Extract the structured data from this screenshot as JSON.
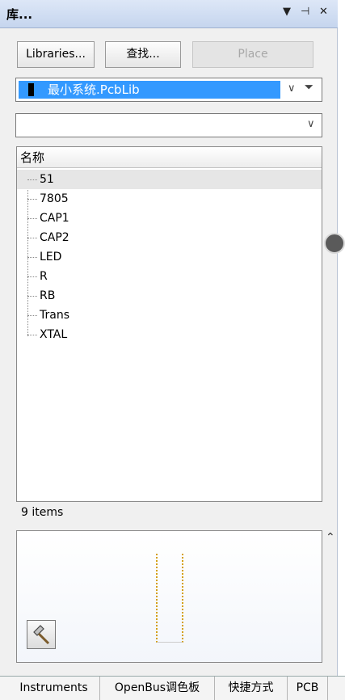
{
  "panel": {
    "title": "库...",
    "title_icons": [
      "dropdown-icon",
      "pin-icon",
      "close-icon"
    ]
  },
  "toolbar": {
    "libraries_label": "Libraries...",
    "search_label": "查找...",
    "place_label": "Place"
  },
  "library_combo": {
    "selected": "最小系统.PcbLib"
  },
  "filter_combo": {
    "value": ""
  },
  "list": {
    "header": "名称",
    "items": [
      "51",
      "7805",
      "CAP1",
      "CAP2",
      "LED",
      "R",
      "RB",
      "Trans",
      "XTAL"
    ],
    "selected_index": 0,
    "count_text": "9 items"
  },
  "bottom_tabs": [
    {
      "label": "Instruments"
    },
    {
      "label": "OpenBus调色板"
    },
    {
      "label": "快捷方式"
    },
    {
      "label": "PCB"
    }
  ],
  "colors": {
    "selection": "#3399ff",
    "footprint_outline": "#d4a017",
    "titlebar": "#c5d5ee"
  }
}
